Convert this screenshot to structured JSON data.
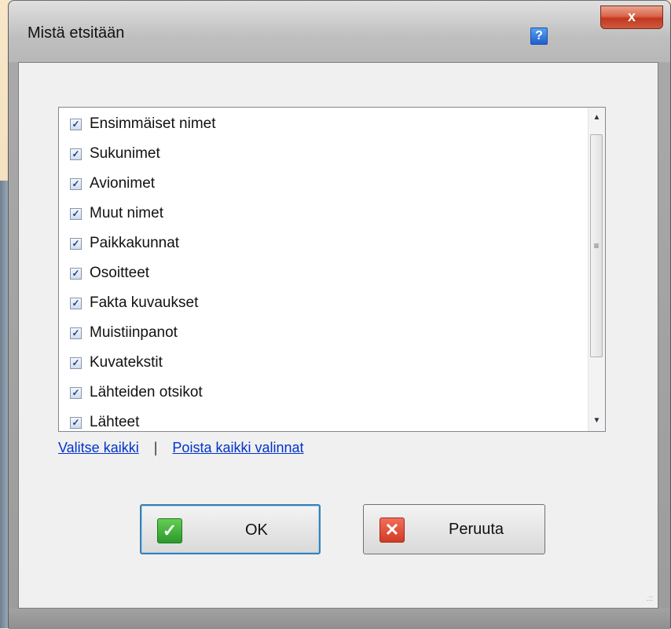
{
  "window": {
    "title": "Mistä etsitään",
    "help_label": "?",
    "close_label": "x"
  },
  "list": {
    "items": [
      {
        "label": "Ensimmäiset nimet",
        "checked": true
      },
      {
        "label": "Sukunimet",
        "checked": true
      },
      {
        "label": "Avionimet",
        "checked": true
      },
      {
        "label": "Muut nimet",
        "checked": true
      },
      {
        "label": "Paikkakunnat",
        "checked": true
      },
      {
        "label": "Osoitteet",
        "checked": true
      },
      {
        "label": "Fakta kuvaukset",
        "checked": true
      },
      {
        "label": "Muistiinpanot",
        "checked": true
      },
      {
        "label": "Kuvatekstit",
        "checked": true
      },
      {
        "label": "Lähteiden otsikot",
        "checked": true
      },
      {
        "label": "Lähteet",
        "checked": true
      }
    ],
    "check_glyph": "✓",
    "scroll_up_glyph": "▲",
    "scroll_down_glyph": "▼",
    "scroll_grip_glyph": "≡"
  },
  "links": {
    "select_all": "Valitse kaikki",
    "separator": "|",
    "clear_all": "Poista kaikki valinnat"
  },
  "buttons": {
    "ok_label": "OK",
    "ok_icon_glyph": "✓",
    "ok_icon": "checkmark-icon",
    "cancel_label": "Peruuta",
    "cancel_icon_glyph": "✕",
    "cancel_icon": "cross-icon"
  },
  "colors": {
    "link": "#0033cc",
    "ok_icon": "#2a9a2a",
    "cancel_icon": "#d23b24",
    "close_button": "#c1381f",
    "help_button": "#1e5fcf"
  }
}
